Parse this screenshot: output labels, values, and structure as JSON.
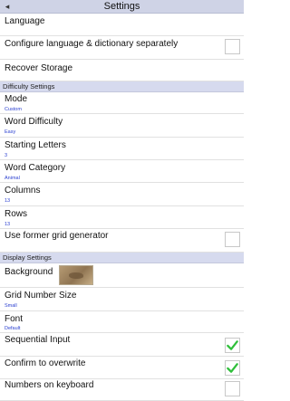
{
  "title_bar": {
    "title": "Settings"
  },
  "rows_general": [
    {
      "label": "Language"
    },
    {
      "label": "Configure language & dictionary separately",
      "checked": false
    },
    {
      "label": "Recover Storage"
    }
  ],
  "difficulty_section": {
    "header": "Difficulty Settings"
  },
  "difficulty_rows": [
    {
      "label": "Mode",
      "value": "Custom"
    },
    {
      "label": "Word Difficulty",
      "value": "Easy"
    },
    {
      "label": "Starting Letters",
      "value": "3"
    },
    {
      "label": "Word Category",
      "value": "Animal"
    },
    {
      "label": "Columns",
      "value": "13"
    },
    {
      "label": "Rows",
      "value": "13"
    },
    {
      "label": "Use former grid generator",
      "checked": false
    }
  ],
  "display_section": {
    "header": "Display Settings"
  },
  "display_rows": [
    {
      "label": "Background"
    },
    {
      "label": "Grid Number Size",
      "value": "Small"
    },
    {
      "label": "Font",
      "value": "Default"
    },
    {
      "label": "Sequential Input",
      "checked": true
    },
    {
      "label": "Confirm to overwrite",
      "checked": true
    },
    {
      "label": "Numbers on keyboard"
    }
  ],
  "colors": {
    "header_bg": "#cfd3e6",
    "section_bg": "#d6daee",
    "value_text": "#2a3fd0",
    "check_green": "#2fbf3a"
  },
  "icons": {
    "back": "back-arrow-icon",
    "check": "checkmark-icon"
  }
}
